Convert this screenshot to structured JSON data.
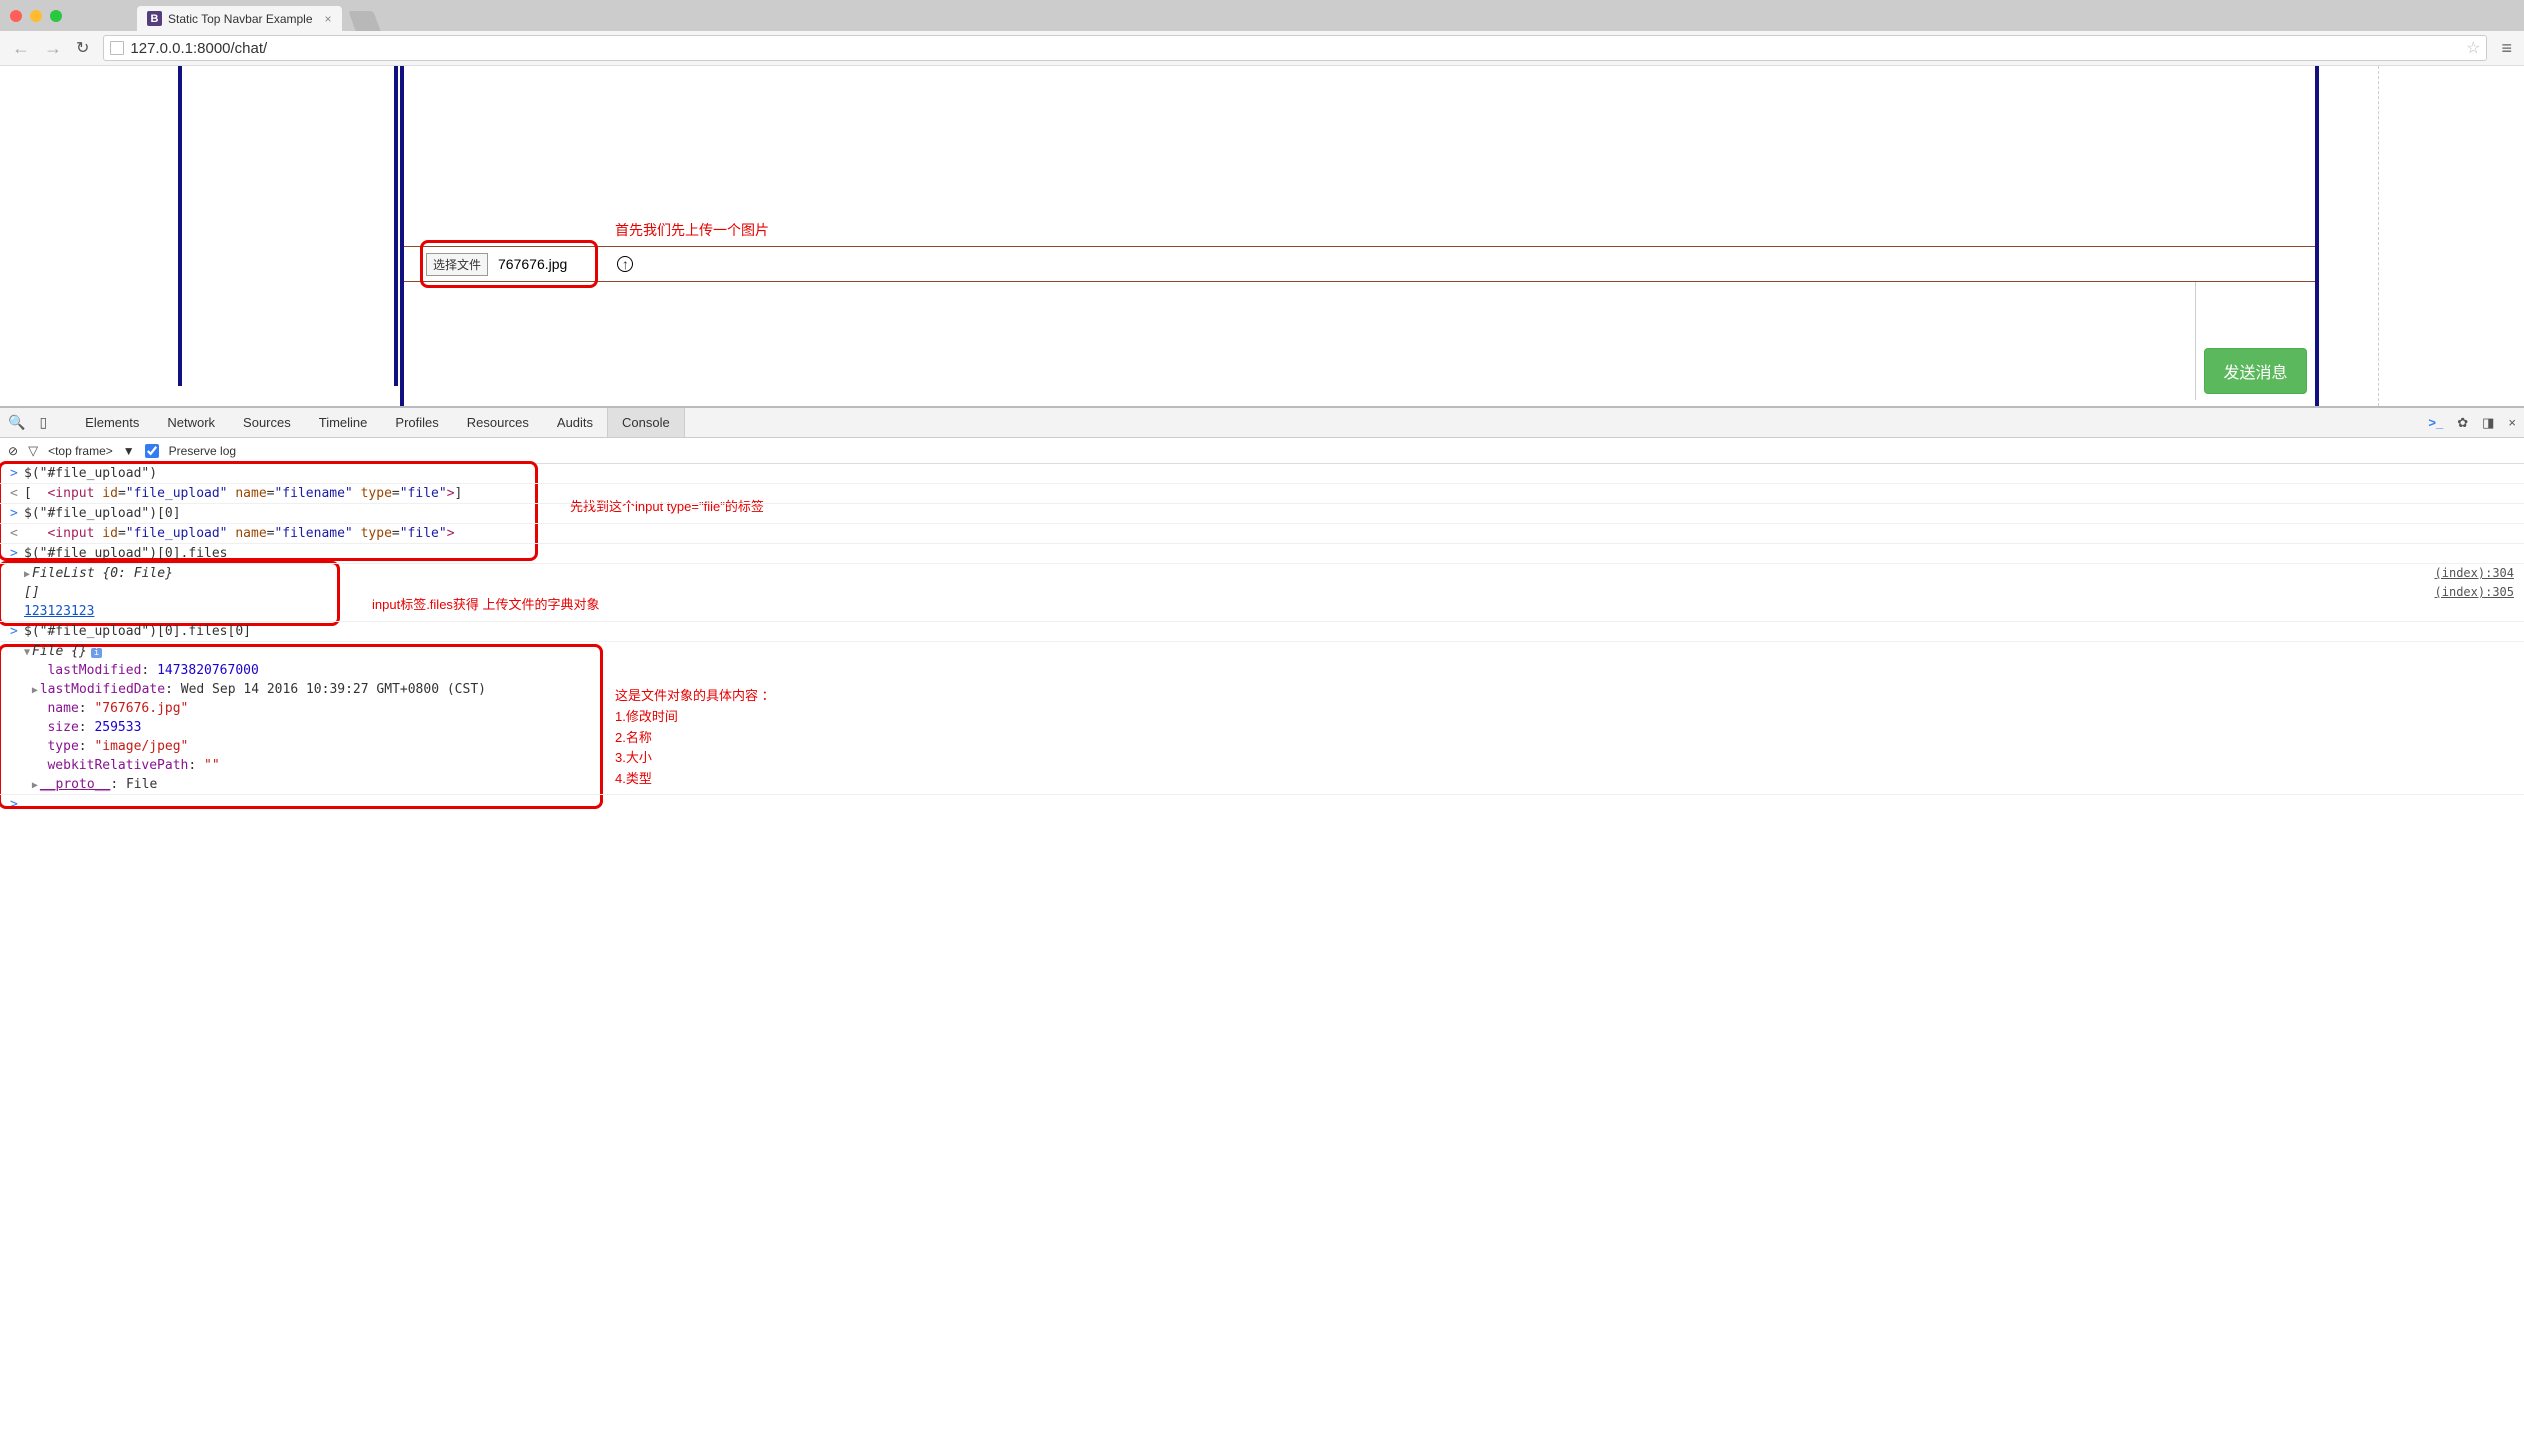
{
  "window": {
    "tab_title": "Static Top Navbar Example",
    "url": "127.0.0.1:8000/chat/"
  },
  "page": {
    "file_button_label": "选择文件",
    "file_name": "767676.jpg",
    "send_button": "发送消息",
    "annotation_upload": "首先我们先上传一个图片"
  },
  "devtools": {
    "tabs": [
      "Elements",
      "Network",
      "Sources",
      "Timeline",
      "Profiles",
      "Resources",
      "Audits",
      "Console"
    ],
    "active_tab": "Console",
    "frame_selector": "<top frame>",
    "preserve_log_label": "Preserve log",
    "preserve_checked": true
  },
  "console": {
    "line1_input": "$(\"#file_upload\")",
    "line2_open": "[  ",
    "line2_close": "]",
    "input_tag_open": "<input ",
    "attr_id": "id",
    "val_id": "\"file_upload\"",
    "attr_name": "name",
    "val_name": "\"filename\"",
    "attr_type": "type",
    "val_type": "\"file\"",
    "input_tag_close": ">",
    "line3_input": "$(\"#file_upload\")[0]",
    "line5_input": "$(\"#file_upload\")[0].files",
    "line6_output": "FileList {0: File}",
    "line7_output": "[]",
    "line8_output": "123123123",
    "line9_input": "$(\"#file_upload\")[0].files[0]",
    "line10_output": "File {}",
    "file_obj": {
      "lastModified_key": "lastModified",
      "lastModified_val": "1473820767000",
      "lastModifiedDate_key": "lastModifiedDate",
      "lastModifiedDate_val": "Wed Sep 14 2016 10:39:27 GMT+0800 (CST)",
      "name_key": "name",
      "name_val": "\"767676.jpg\"",
      "size_key": "size",
      "size_val": "259533",
      "type_key": "type",
      "type_val": "\"image/jpeg\"",
      "webkit_key": "webkitRelativePath",
      "webkit_val": "\"\"",
      "proto_key": "__proto__",
      "proto_val": "File"
    },
    "src_link_304": "(index):304",
    "src_link_305": "(index):305"
  },
  "annotations": {
    "anno2": "先找到这个input type=\"file\"的标签",
    "anno3": "input标签.files获得 上传文件的字典对象",
    "anno4_title": "这是文件对象的具体内容 ：",
    "anno4_1": "1.修改时间",
    "anno4_2": "2.名称",
    "anno4_3": "3.大小",
    "anno4_4": "4.类型"
  }
}
